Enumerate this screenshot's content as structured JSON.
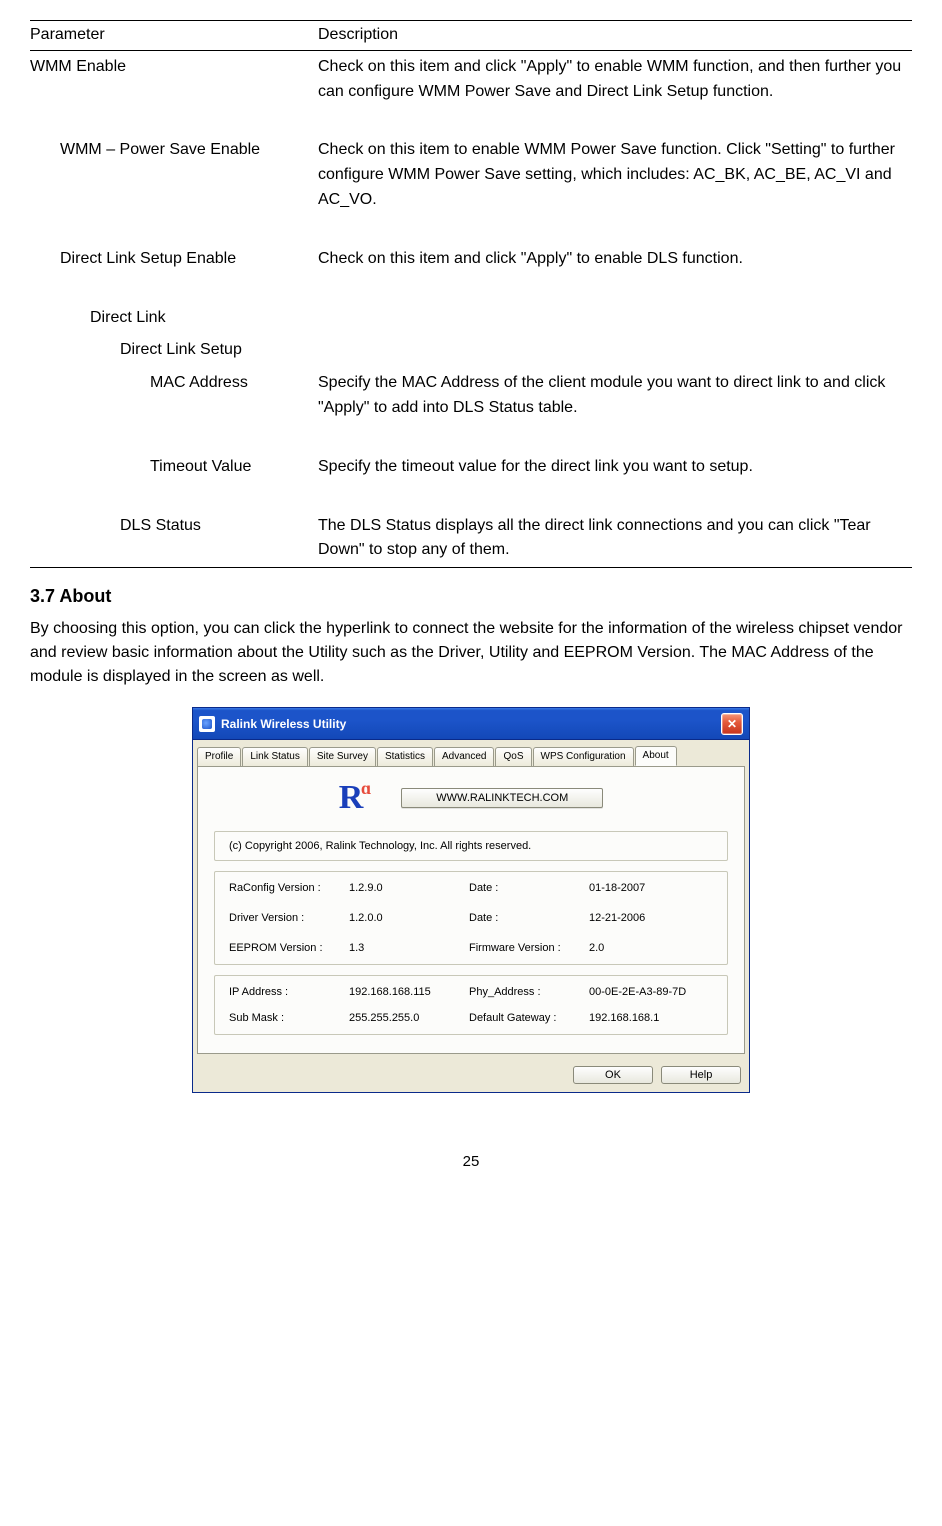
{
  "table": {
    "header": {
      "param": "Parameter",
      "desc": "Description"
    },
    "rows": [
      {
        "param": "WMM Enable",
        "indent": 0,
        "desc": "Check on this item and click \"Apply\" to enable WMM function, and then further you can configure WMM Power Save and Direct Link Setup function."
      },
      {
        "param": "WMM – Power Save Enable",
        "indent": 1,
        "desc": "Check on this item to enable WMM Power Save function. Click \"Setting\" to further configure WMM Power Save setting, which includes: AC_BK, AC_BE, AC_VI and AC_VO."
      },
      {
        "param": "Direct Link Setup Enable",
        "indent": 1,
        "desc": "Check on this item and click \"Apply\" to enable DLS function."
      },
      {
        "param": "Direct Link",
        "indent": 2,
        "desc": ""
      },
      {
        "param": "Direct Link Setup",
        "indent": 3,
        "desc": ""
      },
      {
        "param": "MAC Address",
        "indent": 4,
        "desc": "Specify the MAC Address of the client module you want to direct link to and click \"Apply\" to add into DLS Status table."
      },
      {
        "param": "Timeout Value",
        "indent": 4,
        "desc": "Specify the timeout value for the direct link you want to setup."
      },
      {
        "param": "DLS Status",
        "indent": 3,
        "desc": "The DLS Status displays all the direct link connections and you can click \"Tear Down\" to stop any of them."
      }
    ]
  },
  "section": {
    "heading": "3.7    About",
    "body": "By choosing this option, you can click the hyperlink to connect the website for the information of the wireless chipset vendor and review basic information about the Utility such as the Driver, Utility and EEPROM Version. The MAC Address of the module is displayed in the screen as well."
  },
  "window": {
    "title": "Ralink Wireless Utility",
    "tabs": [
      "Profile",
      "Link Status",
      "Site Survey",
      "Statistics",
      "Advanced",
      "QoS",
      "WPS Configuration",
      "About"
    ],
    "active_tab": "About",
    "logo_text": "R",
    "website_button": "WWW.RALINKTECH.COM",
    "copyright": "(c) Copyright 2006, Ralink Technology, Inc. All rights reserved.",
    "versions": {
      "raconfig_label": "RaConfig Version :",
      "raconfig_value": "1.2.9.0",
      "raconfig_date_label": "Date :",
      "raconfig_date_value": "01-18-2007",
      "driver_label": "Driver Version :",
      "driver_value": "1.2.0.0",
      "driver_date_label": "Date :",
      "driver_date_value": "12-21-2006",
      "eeprom_label": "EEPROM Version :",
      "eeprom_value": "1.3",
      "firmware_label": "Firmware Version :",
      "firmware_value": "2.0"
    },
    "network": {
      "ip_label": "IP Address :",
      "ip_value": "192.168.168.115",
      "phy_label": "Phy_Address :",
      "phy_value": "00-0E-2E-A3-89-7D",
      "mask_label": "Sub Mask :",
      "mask_value": "255.255.255.0",
      "gateway_label": "Default Gateway :",
      "gateway_value": "192.168.168.1"
    },
    "buttons": {
      "ok": "OK",
      "help": "Help"
    }
  },
  "page_number": "25"
}
